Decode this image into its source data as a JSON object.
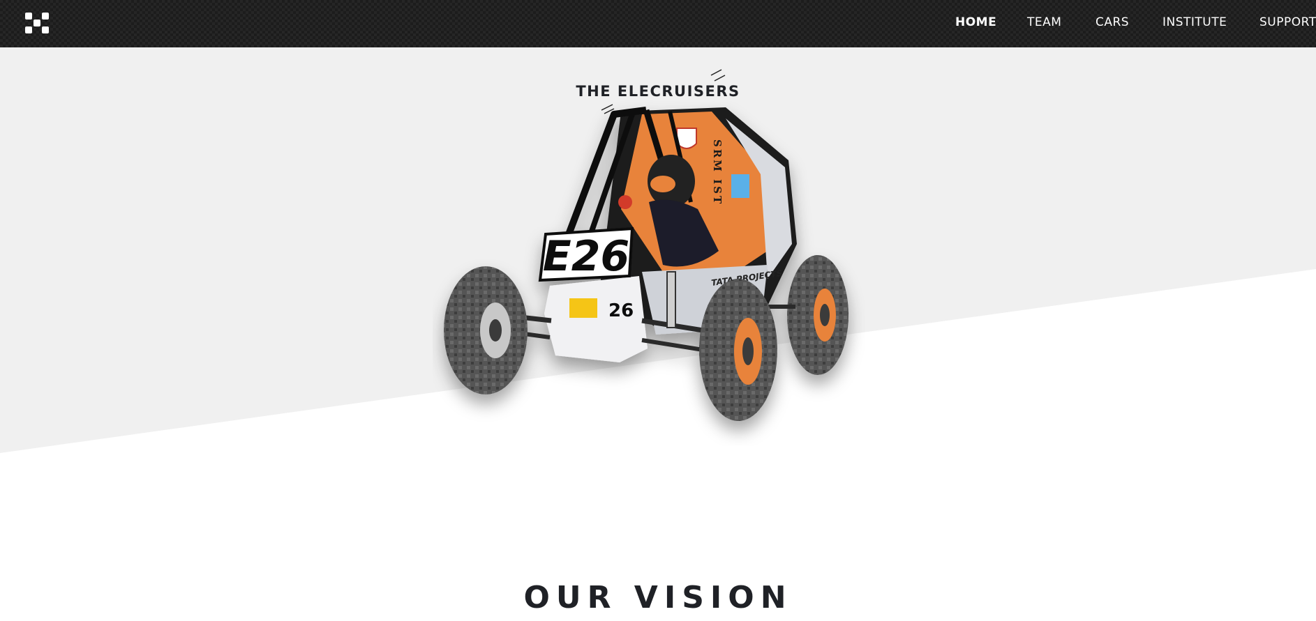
{
  "nav": {
    "links": [
      {
        "label": "HOME",
        "active": true
      },
      {
        "label": "TEAM",
        "active": false
      },
      {
        "label": "CARS",
        "active": false
      },
      {
        "label": "INSTITUTE",
        "active": false
      },
      {
        "label": "SUPPORT",
        "active": false
      }
    ]
  },
  "hero": {
    "title": "THE ELECRUISERS",
    "car": {
      "number_plate": "E26",
      "side_number": "26",
      "side_text": "SRM IST",
      "sponsor_text": "TATA PROJECTS"
    }
  },
  "vision": {
    "title": "OUR VISION"
  },
  "colors": {
    "nav_bg": "#262626",
    "hero_gray": "#f0f0f0",
    "text_dark": "#1f2126",
    "car_orange": "#e8833a",
    "tire": "#505050"
  }
}
